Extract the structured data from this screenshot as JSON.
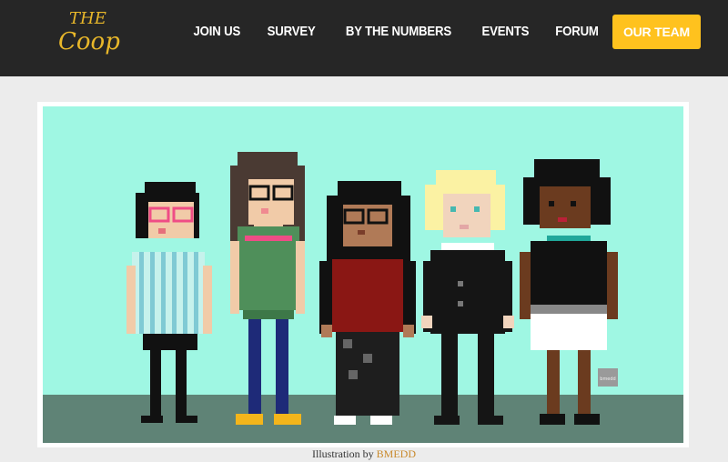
{
  "header": {
    "logo_line1": "THE",
    "logo_line2": "Coop",
    "nav": [
      {
        "label": "JOIN US"
      },
      {
        "label": "SURVEY"
      },
      {
        "label": "BY THE NUMBERS"
      },
      {
        "label": "EVENTS"
      },
      {
        "label": "FORUM"
      },
      {
        "label": "OUR TEAM"
      }
    ]
  },
  "illustration": {
    "signature": "bmedd"
  },
  "caption": {
    "prefix": "Illustration by",
    "credit": "BMEDD"
  },
  "colors": {
    "header_bg": "#262626",
    "accent": "#ffc21e",
    "scene_bg": "#9ff7e3",
    "ground": "#5f8376",
    "credit_link": "#c98a2d"
  }
}
